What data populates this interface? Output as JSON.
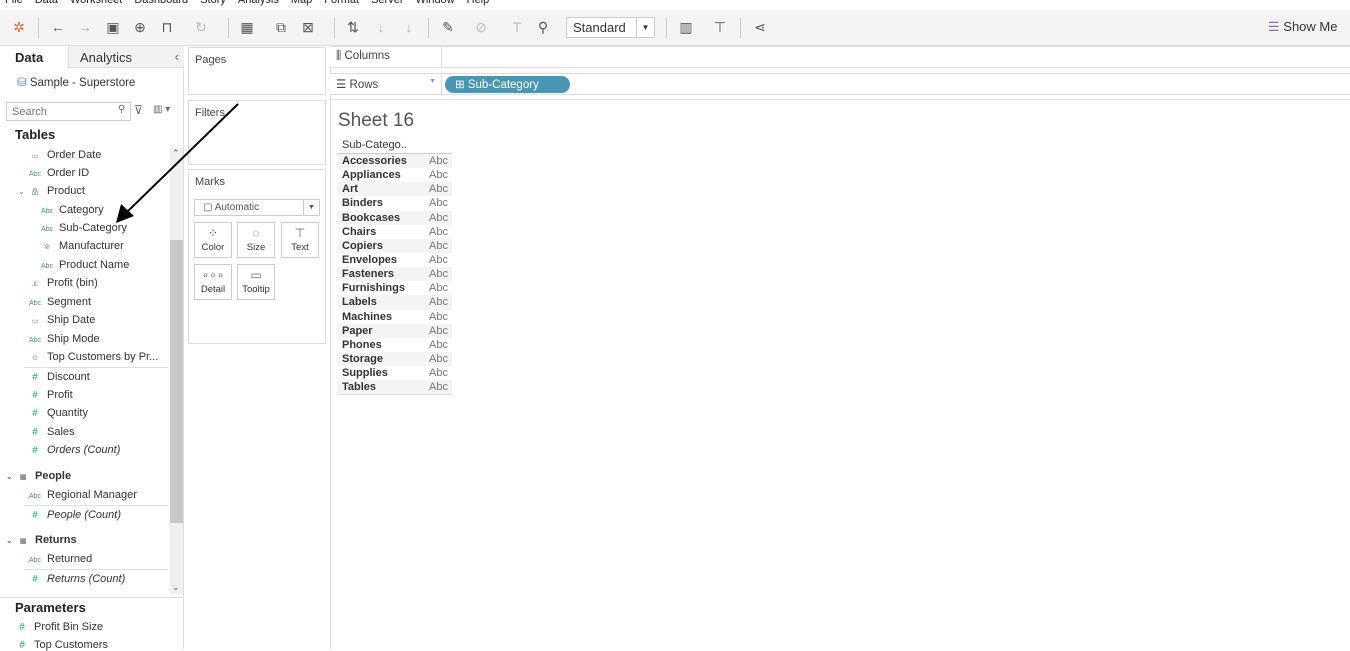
{
  "menu": [
    "File",
    "Data",
    "Worksheet",
    "Dashboard",
    "Story",
    "Analysis",
    "Map",
    "Format",
    "Server",
    "Window",
    "Help"
  ],
  "toolbar": {
    "mark_type": "Standard",
    "show_me": "Show Me"
  },
  "left": {
    "tab_data": "Data",
    "tab_analytics": "Analytics",
    "datasource": "Sample - Superstore",
    "search_placeholder": "Search",
    "tables_title": "Tables",
    "parameters_title": "Parameters",
    "fields": [
      {
        "label": "Order Date",
        "icon": "calendar",
        "indent": 1
      },
      {
        "label": "Order ID",
        "icon": "abc",
        "indent": 1
      },
      {
        "label": "Product",
        "icon": "hierarchy",
        "indent": 1,
        "expand": true
      },
      {
        "label": "Category",
        "icon": "abc",
        "indent": 2
      },
      {
        "label": "Sub-Category",
        "icon": "abc",
        "indent": 2
      },
      {
        "label": "Manufacturer",
        "icon": "group",
        "indent": 2
      },
      {
        "label": "Product Name",
        "icon": "abc",
        "indent": 2
      },
      {
        "label": "Profit (bin)",
        "icon": "bin",
        "indent": 1
      },
      {
        "label": "Segment",
        "icon": "abc",
        "indent": 1
      },
      {
        "label": "Ship Date",
        "icon": "calendar",
        "indent": 1
      },
      {
        "label": "Ship Mode",
        "icon": "abc",
        "indent": 1
      },
      {
        "label": "Top Customers by Pr...",
        "icon": "set",
        "indent": 1,
        "divider": true
      },
      {
        "label": "Discount",
        "icon": "measure",
        "indent": 1
      },
      {
        "label": "Profit",
        "icon": "measure",
        "indent": 1
      },
      {
        "label": "Quantity",
        "icon": "measure",
        "indent": 1
      },
      {
        "label": "Sales",
        "icon": "measure",
        "indent": 1
      },
      {
        "label": "Orders (Count)",
        "icon": "measure",
        "indent": 1,
        "italic": true
      },
      {
        "label": "People",
        "icon": "table",
        "indent": 0,
        "header": true
      },
      {
        "label": "Regional Manager",
        "icon": "abc",
        "indent": 1,
        "divider": true
      },
      {
        "label": "People (Count)",
        "icon": "measure",
        "indent": 1,
        "italic": true
      },
      {
        "label": "Returns",
        "icon": "table",
        "indent": 0,
        "header": true
      },
      {
        "label": "Returned",
        "icon": "abc",
        "indent": 1,
        "divider": true
      },
      {
        "label": "Returns (Count)",
        "icon": "measure",
        "indent": 1,
        "italic": true
      }
    ],
    "parameters": [
      "Profit Bin Size",
      "Top Customers"
    ]
  },
  "cards": {
    "pages": "Pages",
    "filters": "Filters",
    "marks": "Marks",
    "mark_type": "Automatic",
    "buttons": [
      "Color",
      "Size",
      "Text",
      "Detail",
      "Tooltip"
    ]
  },
  "shelves": {
    "columns": "Columns",
    "rows": "Rows",
    "rows_pill": "Sub-Category"
  },
  "sheet": {
    "title": "Sheet 16",
    "header": "Sub-Catego..",
    "placeholder": "Abc",
    "rows": [
      "Accessories",
      "Appliances",
      "Art",
      "Binders",
      "Bookcases",
      "Chairs",
      "Copiers",
      "Envelopes",
      "Fasteners",
      "Furnishings",
      "Labels",
      "Machines",
      "Paper",
      "Phones",
      "Storage",
      "Supplies",
      "Tables"
    ]
  }
}
